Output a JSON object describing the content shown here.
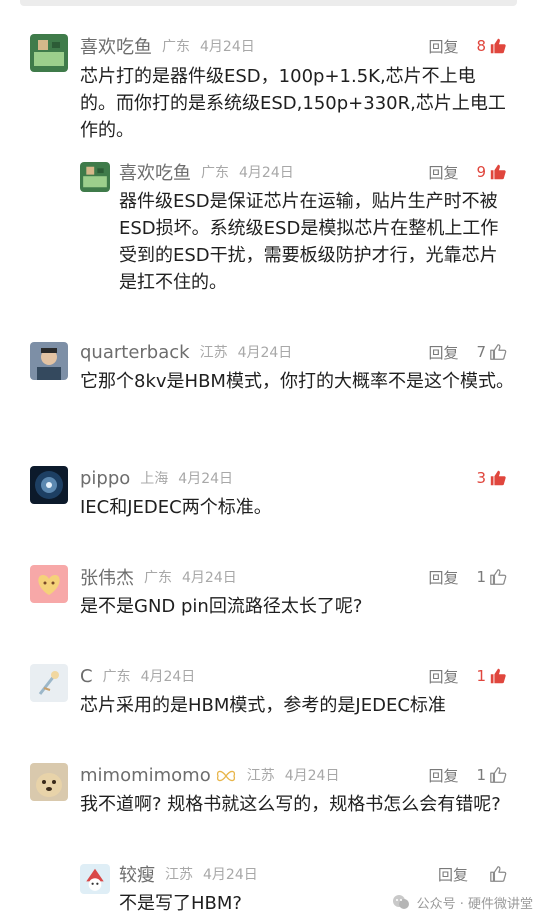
{
  "comments": [
    {
      "name": "喜欢吃鱼",
      "location": "广东",
      "date": "4月24日",
      "reply_label": "回复",
      "likes": "8",
      "liked": true,
      "text": "芯片打的是器件级ESD，100p+1.5K,芯片不上电的。而你打的是系统级ESD,150p+330R,芯片上电工作的。"
    },
    {
      "name": "喜欢吃鱼",
      "location": "广东",
      "date": "4月24日",
      "reply_label": "回复",
      "likes": "9",
      "liked": true,
      "text": "器件级ESD是保证芯片在运输，贴片生产时不被ESD损坏。系统级ESD是模拟芯片在整机上工作受到的ESD干扰，需要板级防护才行，光靠芯片是扛不住的。"
    },
    {
      "name": "quarterback",
      "location": "江苏",
      "date": "4月24日",
      "reply_label": "回复",
      "likes": "7",
      "liked": false,
      "text": "它那个8kv是HBM模式，你打的大概率不是这个模式。"
    },
    {
      "name": "pippo",
      "location": "上海",
      "date": "4月24日",
      "reply_label": "",
      "likes": "3",
      "liked": true,
      "text": "IEC和JEDEC两个标准。"
    },
    {
      "name": "张伟杰",
      "location": "广东",
      "date": "4月24日",
      "reply_label": "回复",
      "likes": "1",
      "liked": false,
      "text": "是不是GND pin回流路径太长了呢?"
    },
    {
      "name": "C",
      "location": "广东",
      "date": "4月24日",
      "reply_label": "回复",
      "likes": "1",
      "liked": true,
      "text": "芯片采用的是HBM模式，参考的是JEDEC标准"
    },
    {
      "name": "mimomimomo",
      "location": "江苏",
      "date": "4月24日",
      "reply_label": "回复",
      "likes": "1",
      "liked": false,
      "text": "我不道啊? 规格书就这么写的，规格书怎么会有错呢?"
    },
    {
      "name": "较瘦",
      "location": "江苏",
      "date": "4月24日",
      "reply_label": "回复",
      "likes": "",
      "liked": false,
      "text": "不是写了HBM?"
    }
  ],
  "watermark": {
    "text": "公众号 · 硬件微讲堂"
  },
  "colors": {
    "name": "#6d6d6d",
    "meta": "#a8a8a8",
    "liked": "#e0463d",
    "text": "#1f1f1f"
  }
}
